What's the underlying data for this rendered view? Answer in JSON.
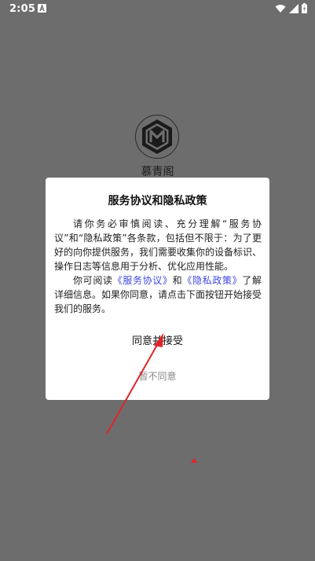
{
  "status_bar": {
    "time": "2:05",
    "icons": [
      "notification-a-icon",
      "wifi-icon",
      "cellular-signal-icon",
      "battery-icon"
    ]
  },
  "app": {
    "name": "慕青阁",
    "logo_icon": "m-shield-logo"
  },
  "dialog": {
    "title": "服务协议和隐私政策",
    "paragraph1": "请你务必审慎阅读、充分理解“服务协议”和“隐私政策”各条款，包括但不限于：为了更好的向你提供服务，我们需要收集你的设备标识、操作日志等信息用于分析、优化应用性能。",
    "p2_pre": "你可阅读",
    "link_service": "《服务协议》",
    "p2_and": "和",
    "link_privacy": "《隐私政策》",
    "p2_post": "了解详细信息。如果你同意，请点击下面按钮开始接受我们的服务。",
    "agree_label": "同意并接受",
    "decline_label": "暂不同意"
  },
  "colors": {
    "overlay": "#6d6d6d",
    "link": "#3c48e0",
    "annotation_arrow": "#e0242a"
  }
}
